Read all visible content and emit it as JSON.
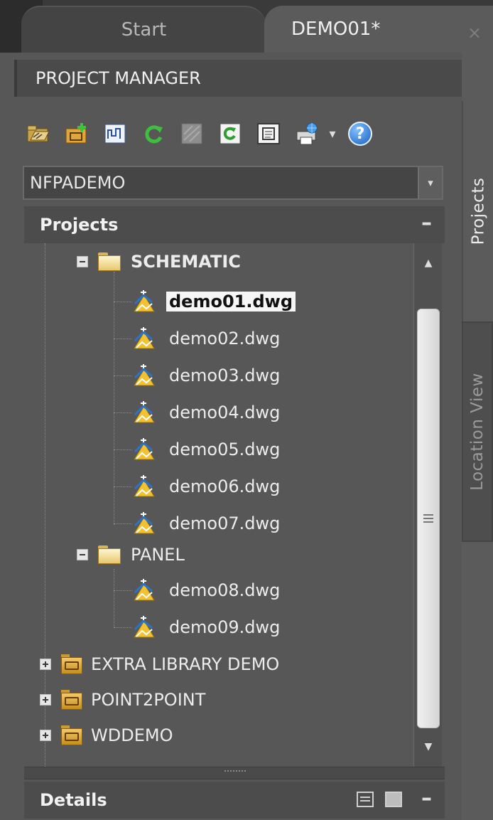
{
  "tabs": [
    {
      "label": "Start",
      "active": false
    },
    {
      "label": "DEMO01*",
      "active": true
    }
  ],
  "tab_close": "×",
  "panel_title": "PROJECT MANAGER",
  "side_tabs": {
    "projects": "Projects",
    "location_view": "Location View"
  },
  "toolbar": {
    "icons": [
      "open-project-icon",
      "new-project-icon",
      "project-properties-icon",
      "refresh-icon",
      "title-block-icon",
      "update-drawings-icon",
      "reports-icon",
      "publish-icon",
      "dropdown-icon",
      "help-icon"
    ],
    "help_label": "?"
  },
  "project_select": {
    "value": "NFPADEMO",
    "arrow": "▾"
  },
  "projects_section": {
    "title": "Projects",
    "collapse": "–"
  },
  "tree": {
    "schematic_folder": "SCHEMATIC",
    "schematic_files": [
      "demo01.dwg",
      "demo02.dwg",
      "demo03.dwg",
      "demo04.dwg",
      "demo05.dwg",
      "demo06.dwg",
      "demo07.dwg"
    ],
    "panel_folder": "PANEL",
    "panel_files": [
      "demo08.dwg",
      "demo09.dwg"
    ],
    "other_projects": [
      "EXTRA LIBRARY DEMO",
      "POINT2POINT",
      "WDDEMO"
    ],
    "selected_file": "demo01.dwg"
  },
  "scrollbar": {
    "up": "▲",
    "down": "▼"
  },
  "details_section": {
    "title": "Details",
    "collapse": "–"
  },
  "colors": {
    "panel_bg": "#575757",
    "header_bg": "#4a4a4a",
    "selected_bg": "#f6f6f6"
  }
}
